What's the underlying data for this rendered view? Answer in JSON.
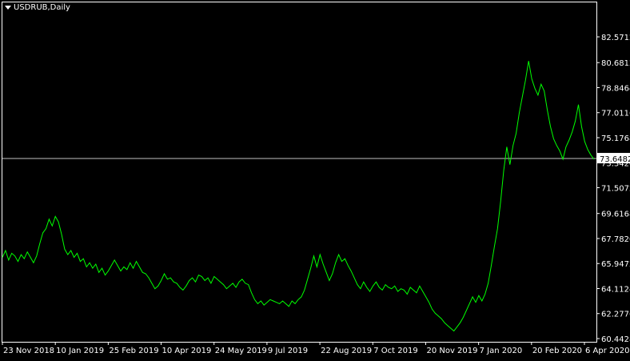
{
  "window": {
    "symbol_title": "USDRUB,Daily",
    "menu_icon": "triangle-down-icon"
  },
  "colors": {
    "background": "#000000",
    "frame": "#ffffff",
    "price_line": "#00ff00",
    "current_price_line": "#c0c0c0",
    "text": "#ffffff"
  },
  "chart_data": {
    "type": "line",
    "ylim": [
      60.4428,
      83.5712
    ],
    "y_ticks": [
      "82.5712",
      "80.6812",
      "78.8464",
      "77.0116",
      "75.1768",
      "73.3420",
      "71.5072",
      "69.6168",
      "67.7820",
      "65.9472",
      "64.1124",
      "62.2776",
      "60.4428"
    ],
    "current_price": 73.6482,
    "current_price_label": "73.6482",
    "x_tick_labels": [
      "23 Nov 2018",
      "10 Jan 2019",
      "25 Feb 2019",
      "10 Apr 2019",
      "24 May 2019",
      "9 Jul 2019",
      "22 Aug 2019",
      "7 Oct 2019",
      "20 Nov 2019",
      "7 Jan 2020",
      "20 Feb 2020",
      "6 Apr 2020"
    ],
    "series": [
      {
        "values": [
          66.4,
          66.9,
          66.2,
          66.7,
          66.5,
          66.1,
          66.6,
          66.3,
          66.8,
          66.4,
          66.0,
          66.5,
          67.4,
          68.2,
          68.5,
          69.2,
          68.7,
          69.4,
          69.0,
          68.1,
          67.0,
          66.6,
          66.9,
          66.4,
          66.7,
          66.1,
          66.3,
          65.7,
          66.0,
          65.6,
          65.9,
          65.3,
          65.6,
          65.1,
          65.4,
          65.8,
          66.2,
          65.8,
          65.4,
          65.7,
          65.5,
          66.0,
          65.6,
          66.1,
          65.7,
          65.3,
          65.2,
          64.9,
          64.5,
          64.1,
          64.3,
          64.7,
          65.2,
          64.8,
          64.9,
          64.6,
          64.5,
          64.2,
          64.0,
          64.3,
          64.7,
          64.9,
          64.6,
          65.1,
          65.0,
          64.7,
          64.9,
          64.5,
          65.0,
          64.8,
          64.6,
          64.4,
          64.1,
          64.3,
          64.5,
          64.2,
          64.6,
          64.8,
          64.5,
          64.4,
          63.8,
          63.3,
          63.0,
          63.2,
          62.9,
          63.1,
          63.3,
          63.2,
          63.1,
          63.0,
          63.2,
          63.0,
          62.8,
          63.2,
          63.0,
          63.3,
          63.5,
          64.0,
          64.8,
          65.6,
          66.5,
          65.7,
          66.6,
          65.9,
          65.3,
          64.7,
          65.2,
          66.0,
          66.6,
          66.1,
          66.3,
          65.8,
          65.4,
          64.9,
          64.4,
          64.1,
          64.6,
          64.2,
          63.9,
          64.3,
          64.6,
          64.2,
          64.0,
          64.4,
          64.2,
          64.1,
          64.3,
          63.9,
          64.1,
          64.0,
          63.7,
          64.2,
          64.0,
          63.8,
          64.3,
          63.9,
          63.5,
          63.1,
          62.6,
          62.3,
          62.1,
          61.9,
          61.6,
          61.4,
          61.2,
          61.0,
          61.3,
          61.6,
          62.0,
          62.5,
          63.0,
          63.5,
          63.1,
          63.6,
          63.2,
          63.7,
          64.5,
          65.8,
          67.2,
          68.5,
          70.5,
          72.8,
          74.5,
          73.2,
          74.6,
          75.5,
          77.0,
          78.2,
          79.4,
          80.8,
          79.5,
          78.8,
          78.3,
          79.1,
          78.6,
          77.2,
          76.0,
          75.1,
          74.6,
          74.2,
          73.6,
          74.5,
          75.0,
          75.6,
          76.4,
          77.6,
          76.0,
          74.9,
          74.3,
          73.9,
          73.6
        ]
      }
    ]
  }
}
